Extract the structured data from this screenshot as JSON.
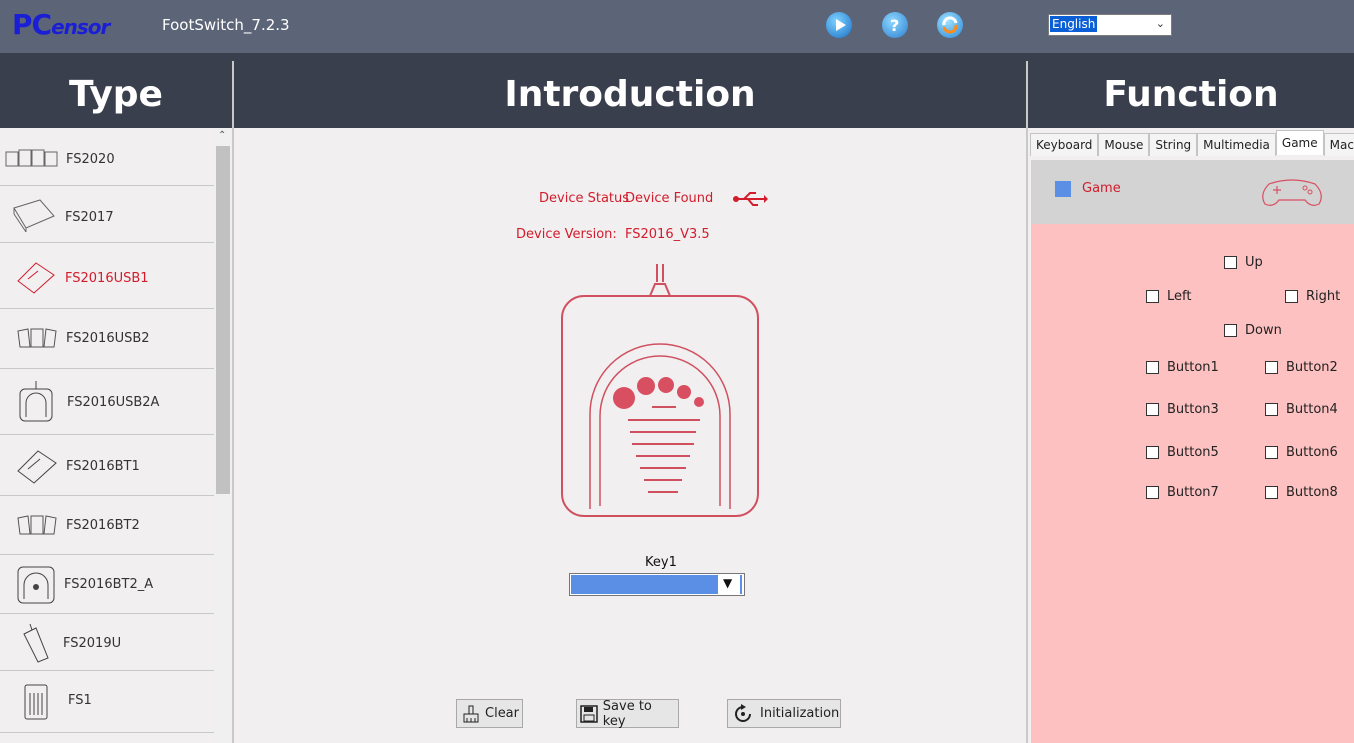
{
  "app": {
    "logo_main": "PC",
    "logo_sub": "ensor",
    "title": "FootSwitch_7.2.3",
    "language": "English"
  },
  "headers": {
    "type": "Type",
    "introduction": "Introduction",
    "function": "Function"
  },
  "types": [
    {
      "label": "FS2020",
      "selected": false
    },
    {
      "label": "FS2017",
      "selected": false
    },
    {
      "label": "FS2016USB1",
      "selected": true
    },
    {
      "label": "FS2016USB2",
      "selected": false
    },
    {
      "label": "FS2016USB2A",
      "selected": false
    },
    {
      "label": "FS2016BT1",
      "selected": false
    },
    {
      "label": "FS2016BT2",
      "selected": false
    },
    {
      "label": "FS2016BT2_A",
      "selected": false
    },
    {
      "label": "FS2019U",
      "selected": false
    },
    {
      "label": "FS1",
      "selected": false
    }
  ],
  "device": {
    "status_label": "Device Status",
    "status_value": "Device Found",
    "version_label": "Device Version:",
    "version_value": "FS2016_V3.5"
  },
  "key": {
    "label": "Key1"
  },
  "buttons": {
    "clear": "Clear",
    "save": "Save to key",
    "init": "Initialization"
  },
  "function_tabs": [
    "Keyboard",
    "Mouse",
    "String",
    "Multimedia",
    "Game",
    "Mac"
  ],
  "active_tab": "Game",
  "game": {
    "mode_label": "Game",
    "checkboxes": {
      "up": "Up",
      "left": "Left",
      "right": "Right",
      "down": "Down",
      "b1": "Button1",
      "b2": "Button2",
      "b3": "Button3",
      "b4": "Button4",
      "b5": "Button5",
      "b6": "Button6",
      "b7": "Button7",
      "b8": "Button8"
    }
  },
  "colors": {
    "accent_red": "#d21c2c",
    "header_bg": "#3a3f4e",
    "topbar_bg": "#5c6478",
    "game_panel": "#fec1c1",
    "selection_blue": "#5b8fe6"
  }
}
